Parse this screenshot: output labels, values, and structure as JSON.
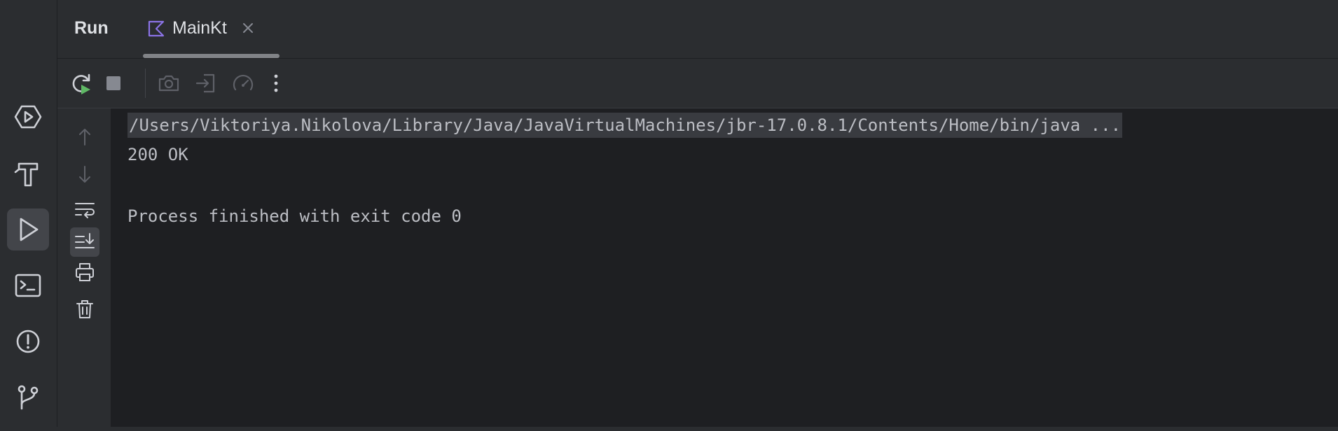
{
  "tool_window": {
    "title": "Run",
    "tab": {
      "label": "MainKt",
      "icon": "kotlin-icon",
      "close_icon": "close-icon"
    }
  },
  "left_strip": {
    "items": [
      {
        "name": "services",
        "icon": "services-icon",
        "active": false
      },
      {
        "name": "build",
        "icon": "hammer-icon",
        "active": false
      },
      {
        "name": "run",
        "icon": "run-icon",
        "active": true
      },
      {
        "name": "terminal",
        "icon": "terminal-icon",
        "active": false
      },
      {
        "name": "problems",
        "icon": "problems-icon",
        "active": false
      },
      {
        "name": "git",
        "icon": "git-branch-icon",
        "active": false
      }
    ]
  },
  "toolbar": {
    "items": [
      {
        "icon": "rerun-icon",
        "enabled": true
      },
      {
        "icon": "stop-icon",
        "enabled": true
      },
      {
        "icon": "camera-icon",
        "enabled": false
      },
      {
        "icon": "exit-icon",
        "enabled": false
      },
      {
        "icon": "profiler-icon",
        "enabled": false
      },
      {
        "icon": "more-icon",
        "enabled": true
      }
    ]
  },
  "side_tools": {
    "items": [
      {
        "icon": "arrow-up-icon",
        "enabled": false
      },
      {
        "icon": "arrow-down-icon",
        "enabled": false
      },
      {
        "icon": "soft-wrap-icon",
        "enabled": true
      },
      {
        "icon": "scroll-to-end-icon",
        "enabled": true,
        "active": true
      },
      {
        "icon": "print-icon",
        "enabled": true
      },
      {
        "icon": "trash-icon",
        "enabled": true
      }
    ]
  },
  "console": {
    "command": "/Users/Viktoriya.Nikolova/Library/Java/JavaVirtualMachines/jbr-17.0.8.1/Contents/Home/bin/java ...",
    "output": "200 OK",
    "exit_message": "Process finished with exit code 0"
  },
  "colors": {
    "background": "#1e1f22",
    "panel": "#2b2d30",
    "text": "#bcbec4",
    "run_green": "#5fb865",
    "kotlin_purple": "#8b73e6"
  }
}
